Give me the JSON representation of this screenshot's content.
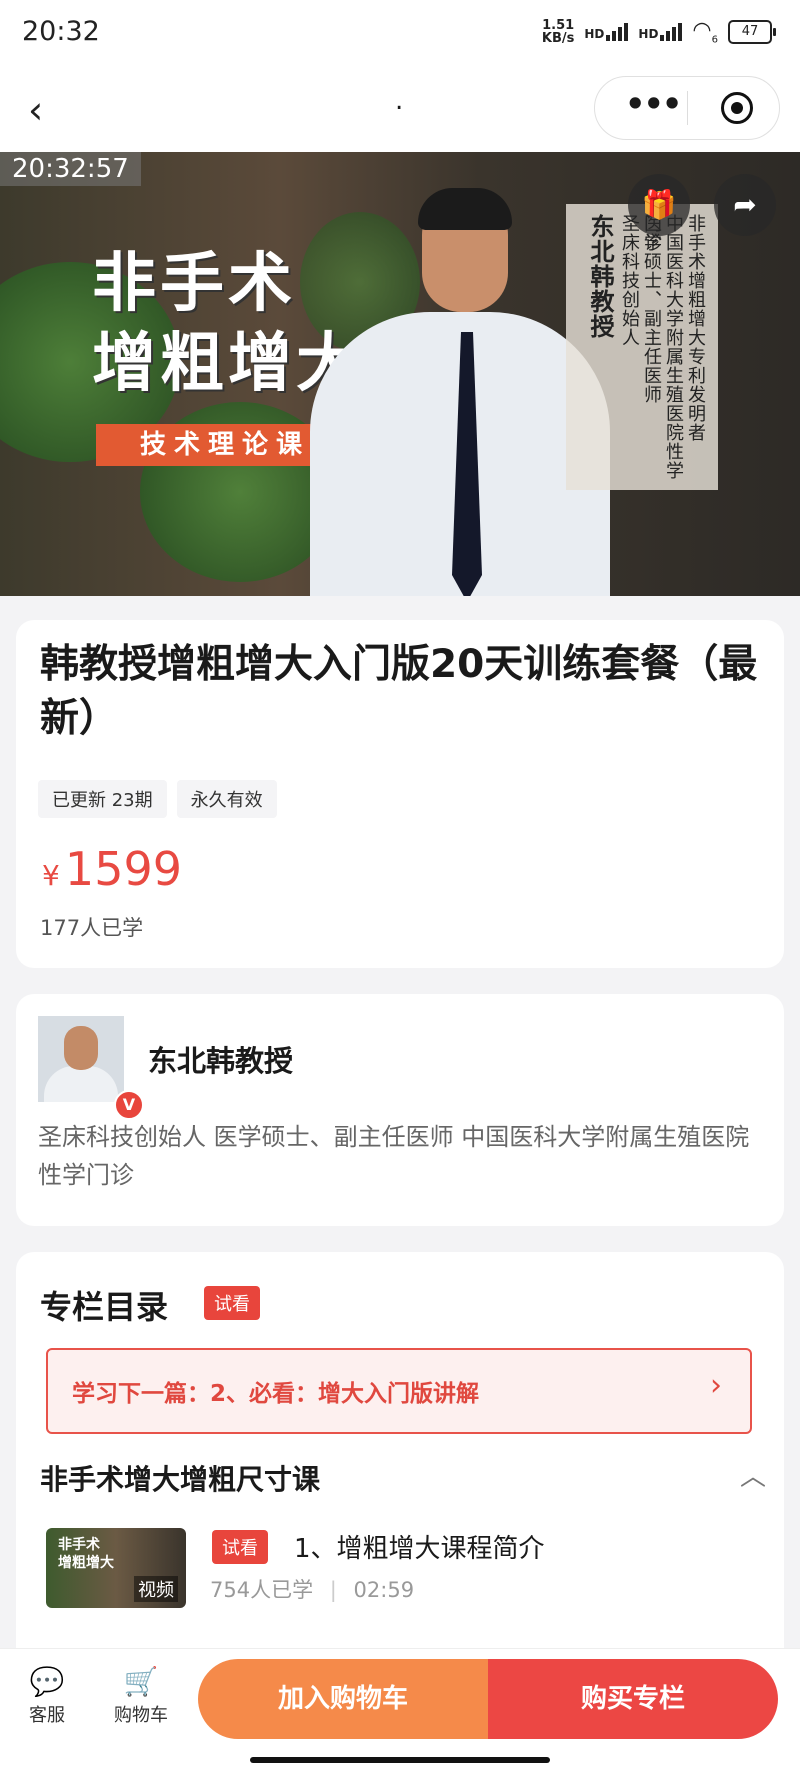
{
  "status": {
    "time": "20:32",
    "speed_top": "1.51",
    "speed_unit": "KB/s",
    "sig1": "HD",
    "sig2": "HD",
    "wifi": "6",
    "battery": "47"
  },
  "nav": {
    "back": "‹",
    "title": ".",
    "more": "•••"
  },
  "hero": {
    "timestamp": "20:32:57",
    "title_line1": "非手术",
    "title_line2": "增粗增大",
    "tag": "技术理论课",
    "vert_col1": "非手术增粗增大专利发明者",
    "vert_col2": "中国医科大学附属生殖医院性学门诊",
    "vert_col3": "医学硕士、副主任医师",
    "vert_col4": "圣床科技创始人",
    "vert_name": "东北韩教授"
  },
  "product": {
    "title": "韩教授增粗增大入门版20天训练套餐（最新）",
    "tag1": "已更新 23期",
    "tag2": "永久有效",
    "currency": "¥",
    "price": "1599",
    "learned": "177人已学"
  },
  "author": {
    "name": "东北韩教授",
    "verified": "V",
    "desc": "圣床科技创始人 医学硕士、副主任医师 中国医科大学附属生殖医院性学门诊"
  },
  "catalog": {
    "title": "专栏目录",
    "badge": "试看",
    "next": "学习下一篇：2、必看：增大入门版讲解",
    "section": "非手术增大增粗尺寸课",
    "item": {
      "thumb_title1": "非手术",
      "thumb_title2": "增粗增大",
      "thumb_label": "视频",
      "badge": "试看",
      "title": "1、增粗增大课程简介",
      "learners": "754人已学",
      "duration": "02:59"
    }
  },
  "bottom": {
    "service": "客服",
    "cart": "购物车",
    "add_cart": "加入购物车",
    "buy": "购买专栏"
  }
}
